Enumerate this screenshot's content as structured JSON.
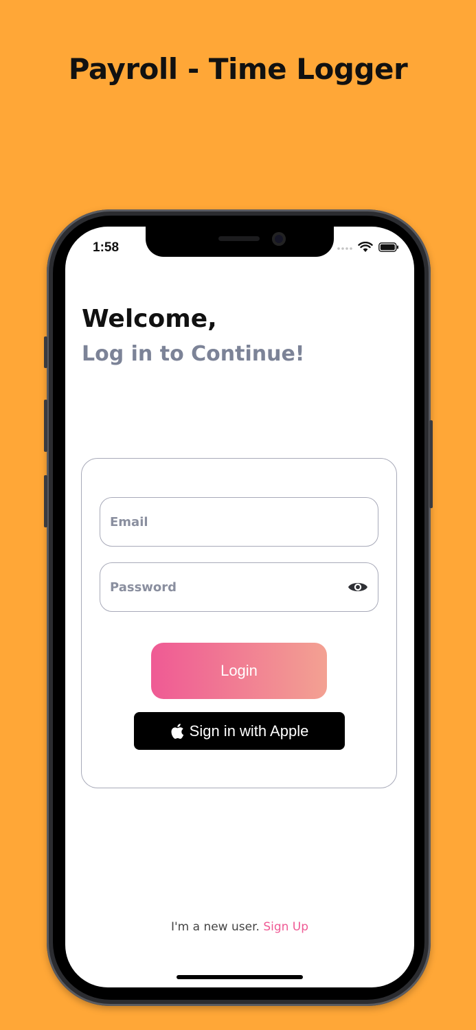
{
  "promo": {
    "title": "Payroll - Time Logger"
  },
  "status_bar": {
    "time": "1:58"
  },
  "header": {
    "welcome": "Welcome,",
    "subtitle": "Log in to Continue!"
  },
  "form": {
    "email": {
      "placeholder": "Email",
      "value": ""
    },
    "password": {
      "placeholder": "Password",
      "value": ""
    },
    "login_label": "Login",
    "apple_label": "Sign in with Apple"
  },
  "footer": {
    "prompt": "I'm a new user.",
    "signup_label": "Sign Up"
  },
  "colors": {
    "background": "#FFA737",
    "accent_pink": "#EF5A94",
    "accent_peach": "#F3A192",
    "subtitle_gray": "#7C8397"
  },
  "icons": [
    "eye-icon",
    "apple-icon",
    "wifi-icon",
    "battery-icon",
    "signal-icon"
  ]
}
